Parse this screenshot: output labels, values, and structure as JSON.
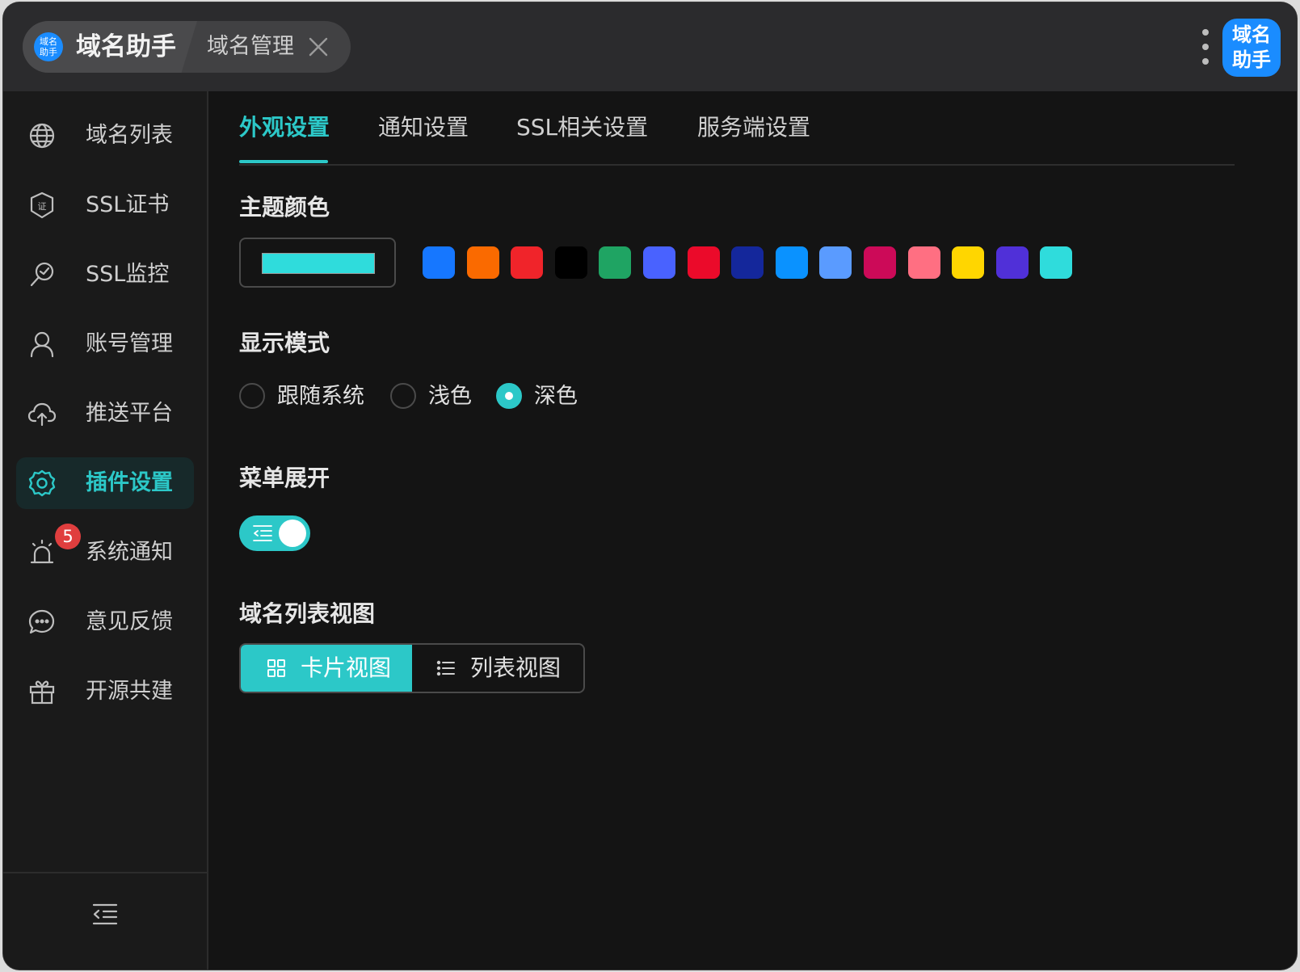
{
  "app": {
    "brand_logo_text": "域名助手",
    "home_tab_label": "域名助手",
    "current_tab_label": "域名管理",
    "avatar_text": "域名助手"
  },
  "sidebar": {
    "items": [
      {
        "label": "域名列表",
        "icon": "globe-icon"
      },
      {
        "label": "SSL证书",
        "icon": "certificate-shield-icon"
      },
      {
        "label": "SSL监控",
        "icon": "monitor-search-icon"
      },
      {
        "label": "账号管理",
        "icon": "user-icon"
      },
      {
        "label": "推送平台",
        "icon": "cloud-upload-icon"
      },
      {
        "label": "插件设置",
        "icon": "gear-icon",
        "active": true
      },
      {
        "label": "系统通知",
        "icon": "alarm-light-icon",
        "badge": "5"
      },
      {
        "label": "意见反馈",
        "icon": "chat-bubbles-icon"
      },
      {
        "label": "开源共建",
        "icon": "gift-icon"
      }
    ],
    "collapse_icon": "menu-collapse-icon"
  },
  "settings": {
    "tabs": [
      "外观设置",
      "通知设置",
      "SSL相关设置",
      "服务端设置"
    ],
    "active_tab": "外观设置",
    "theme_color": {
      "title": "主题颜色",
      "selected": "#2fdcdc",
      "swatches": [
        "#1677ff",
        "#fa6a00",
        "#f0242a",
        "#000000",
        "#1fa463",
        "#4962ff",
        "#eb0a2a",
        "#14279b",
        "#0a92ff",
        "#5a9bff",
        "#cc0a58",
        "#ff6f82",
        "#ffd600",
        "#5030d8",
        "#2fdcdc"
      ]
    },
    "display_mode": {
      "title": "显示模式",
      "options": [
        "跟随系统",
        "浅色",
        "深色"
      ],
      "selected": "深色"
    },
    "menu_expand": {
      "title": "菜单展开",
      "enabled": true
    },
    "list_view": {
      "title": "域名列表视图",
      "options": [
        "卡片视图",
        "列表视图"
      ],
      "selected": "卡片视图"
    }
  },
  "colors": {
    "accent": "#2cc8c8",
    "brand_blue": "#1a8cff",
    "badge_red": "#e03e3e"
  }
}
